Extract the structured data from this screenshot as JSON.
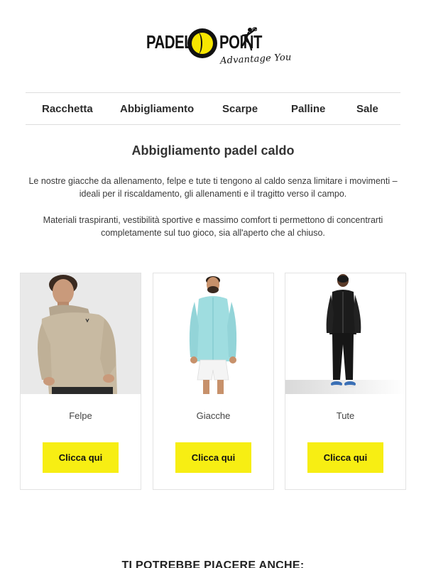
{
  "brand": {
    "name_left": "PADEL",
    "name_right": "POINT",
    "tagline": "Advantage You",
    "ball_color": "#f7e600"
  },
  "nav": {
    "items": [
      {
        "label": "Racchetta"
      },
      {
        "label": "Abbigliamento"
      },
      {
        "label": "Scarpe"
      },
      {
        "label": "Palline"
      },
      {
        "label": "Sale"
      }
    ]
  },
  "section": {
    "title": "Abbigliamento padel caldo",
    "paragraph1": "Le nostre giacche da allenamento, felpe e tute ti tengono al caldo senza limitare i movimenti – ideali per il riscaldamento, gli allenamenti e il tragitto verso il campo.",
    "paragraph2": "Materiali traspiranti, vestibilità sportive e massimo comfort ti permettono di concentrarti completamente sul tuo gioco, sia all'aperto che al chiuso."
  },
  "products": [
    {
      "label": "Felpe",
      "button": "Clicca qui",
      "image_icon": "hoodie-model-photo"
    },
    {
      "label": "Giacche",
      "button": "Clicca qui",
      "image_icon": "jacket-model-photo"
    },
    {
      "label": "Tute",
      "button": "Clicca qui",
      "image_icon": "tracksuit-model-photo"
    }
  ],
  "recommend": {
    "title": "TI POTREBBE PIACERE ANCHE:"
  },
  "colors": {
    "button_bg": "#f7ee13",
    "divider": "#dddddd"
  }
}
